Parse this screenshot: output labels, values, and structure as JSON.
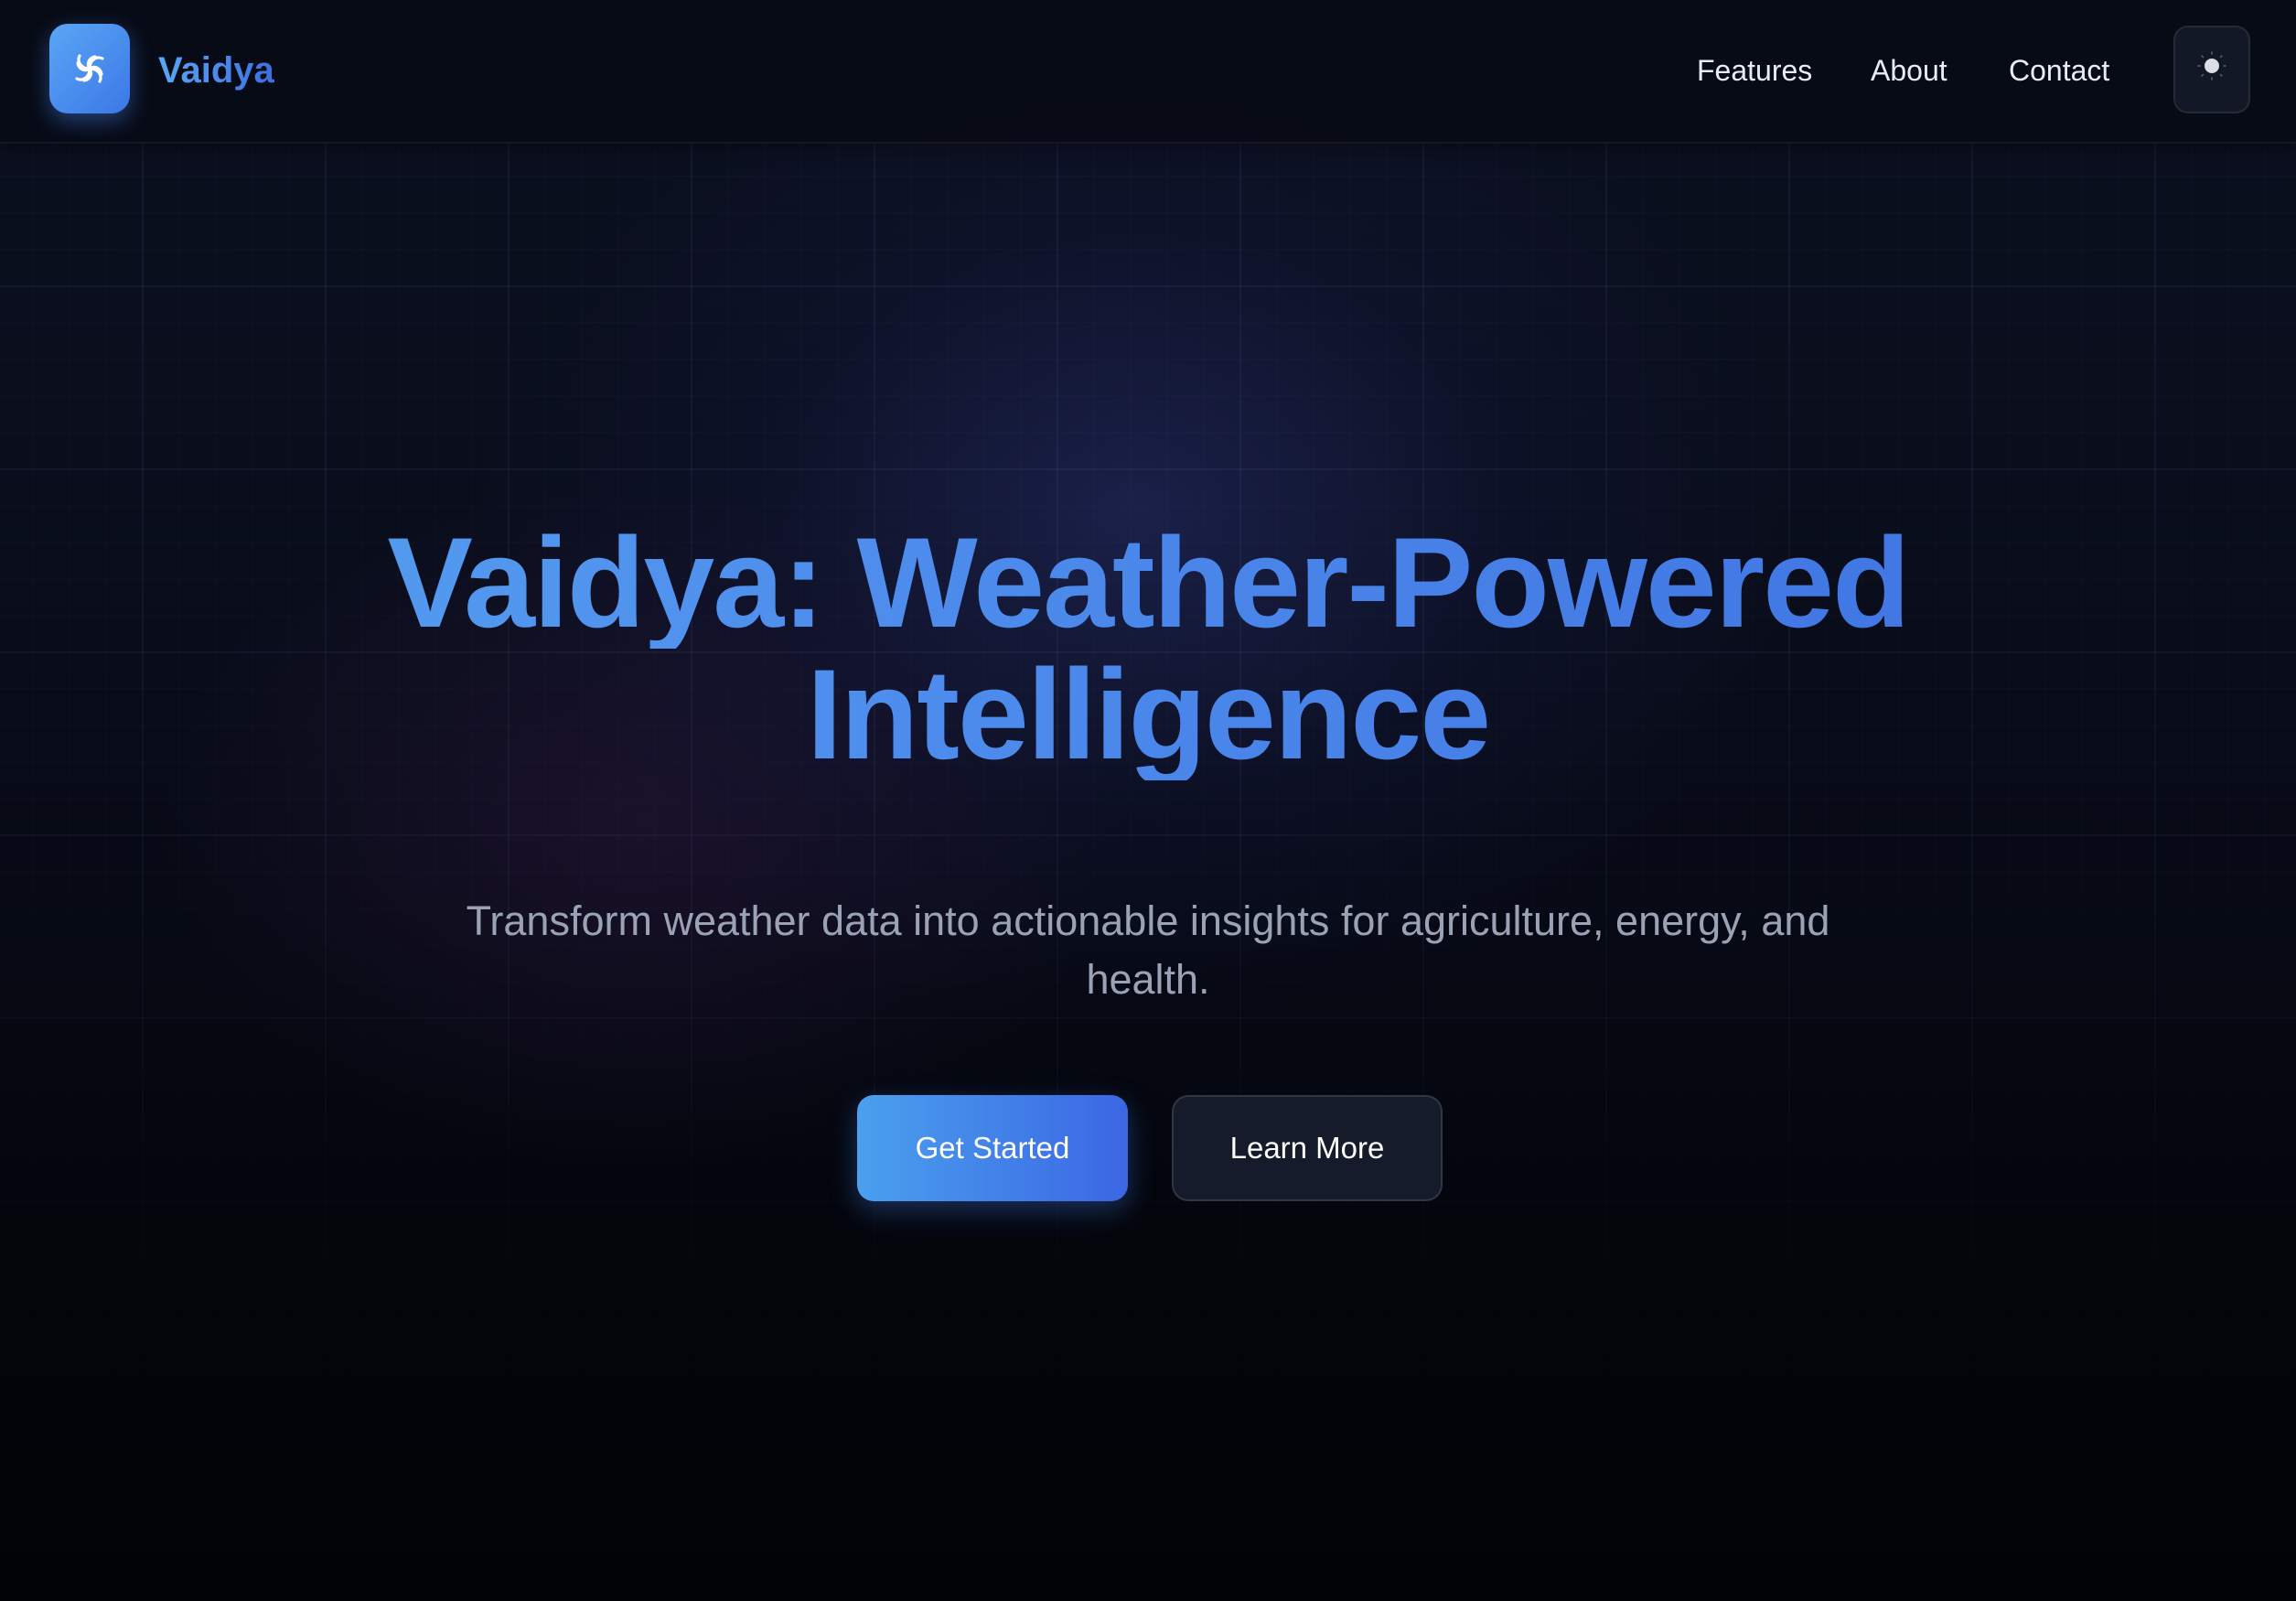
{
  "header": {
    "brand_name": "Vaidya",
    "logo_icon": "swirl-wind-icon",
    "nav": [
      {
        "label": "Features"
      },
      {
        "label": "About"
      },
      {
        "label": "Contact"
      }
    ],
    "theme_toggle_icon": "sun-icon"
  },
  "hero": {
    "title_line1": "Vaidya: Weather-Powered",
    "title_line2": "Intelligence",
    "subtitle": "Transform weather data into actionable insights for agriculture, energy, and health.",
    "primary_button": "Get Started",
    "secondary_button": "Learn More"
  },
  "colors": {
    "accent_start": "#5aa6f5",
    "accent_end": "#3b66e4",
    "background": "#05070f"
  }
}
